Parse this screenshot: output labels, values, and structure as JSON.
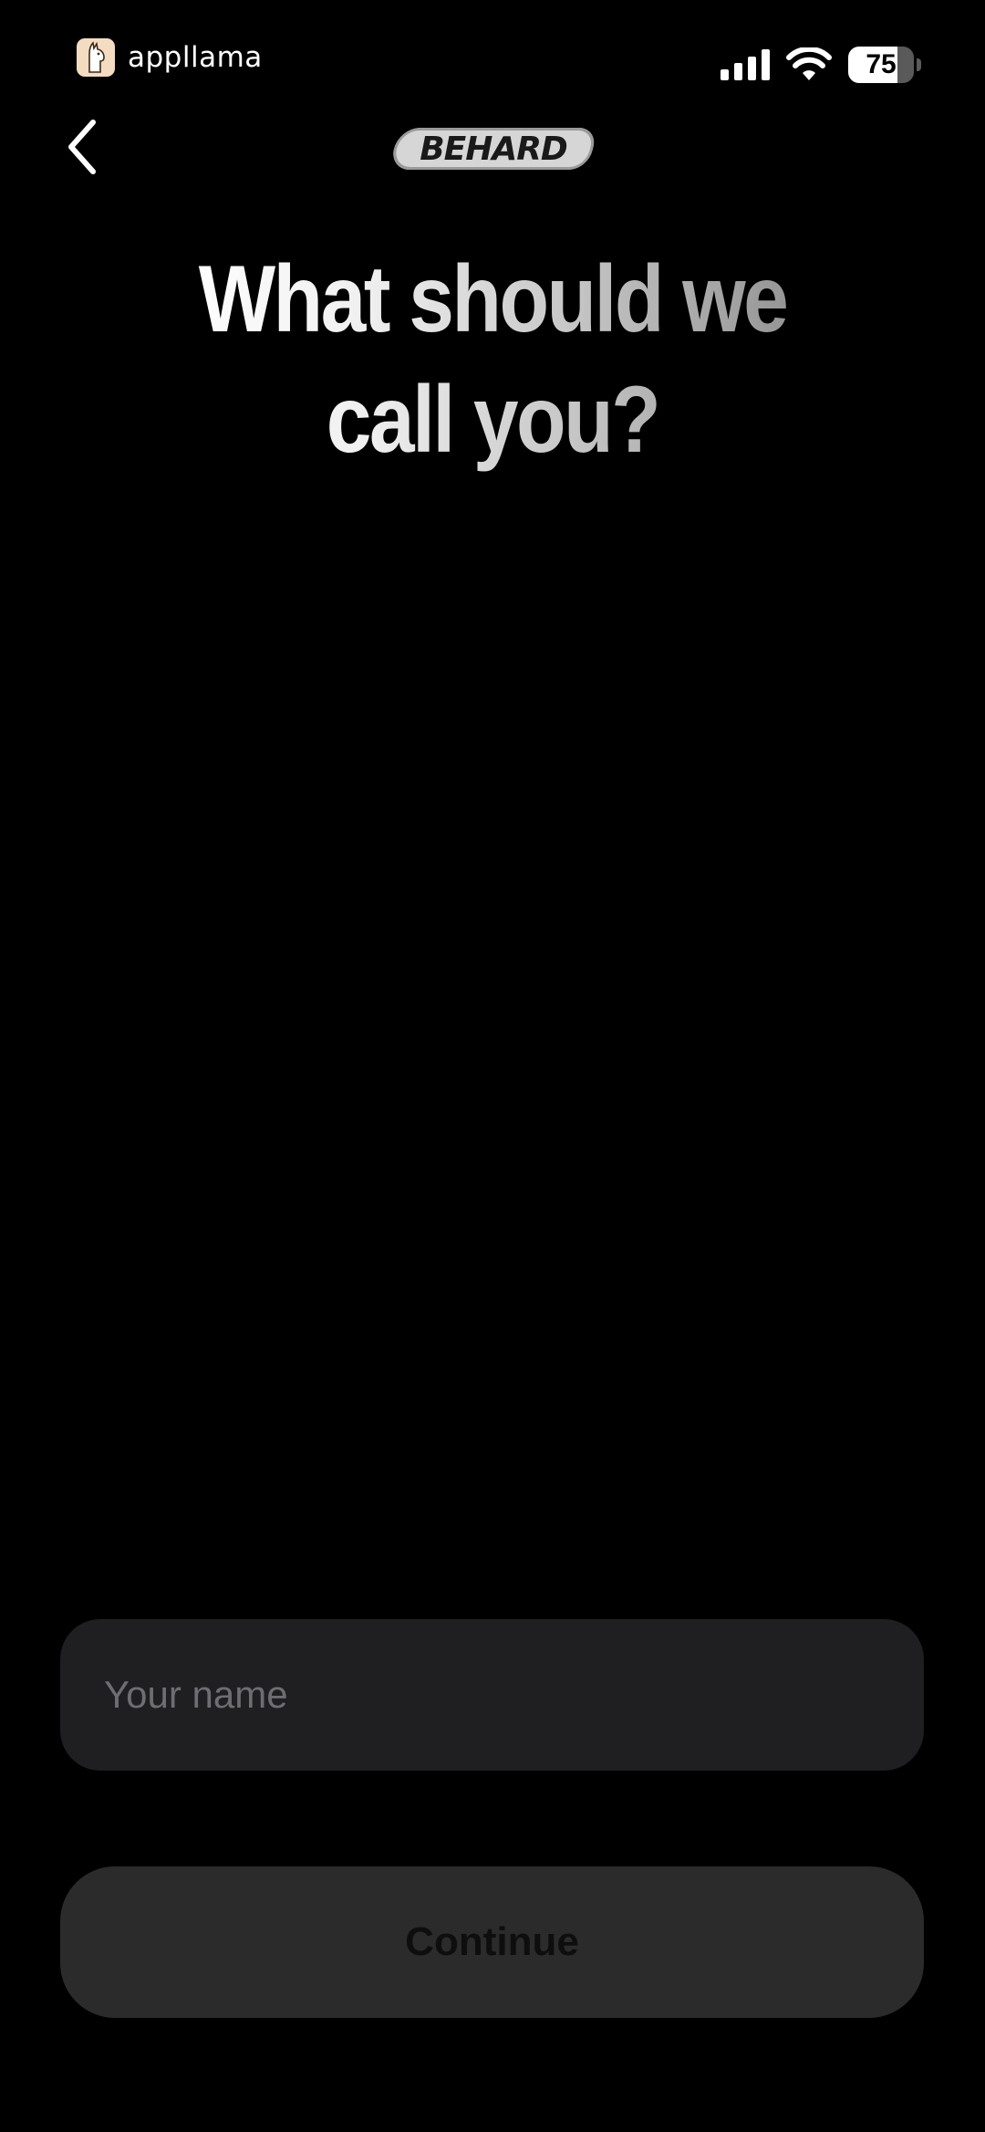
{
  "status_bar": {
    "carrier": "appllama",
    "carrier_icon": "llama-icon",
    "signal_icon": "cellular-signal-icon",
    "wifi_icon": "wifi-icon",
    "battery_level": "75",
    "battery_fraction": 0.75
  },
  "nav": {
    "back_icon": "chevron-left-icon",
    "brand": "BEHARD"
  },
  "main": {
    "title_line1": "What should we",
    "title_line2": "call you?"
  },
  "form": {
    "name_placeholder": "Your name",
    "name_value": "",
    "continue_label": "Continue"
  },
  "colors": {
    "background": "#000000",
    "input_background": "#1f1f22",
    "button_disabled_background": "#2b2b2b",
    "placeholder": "#6d6d72"
  }
}
